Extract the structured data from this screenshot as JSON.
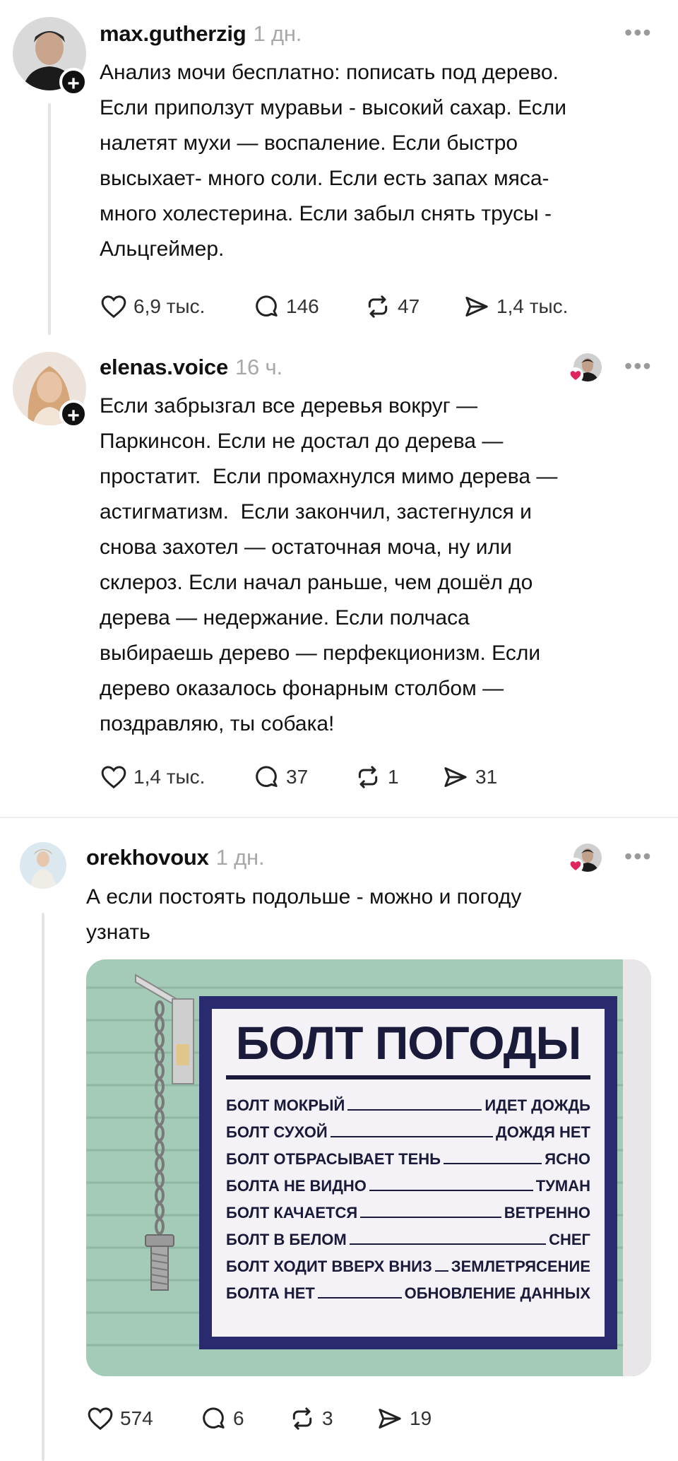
{
  "posts": [
    {
      "username": "max.gutherzig",
      "time": "1 дн.",
      "text": "Анализ мочи бесплатно: пописать под дерево.\nЕсли приползут муравьи - высокий сахар. Если\nналетят мухи — воспаление. Если быстро\nвысыхает- много соли. Если есть запах мяса-\nмного холестерина. Если забыл снять трусы -\nАльцгеймер.",
      "likes": "6,9 тыс.",
      "comments": "146",
      "reposts": "47",
      "shares": "1,4 тыс."
    },
    {
      "username": "elenas.voice",
      "time": "16 ч.",
      "text": "Если забрызгал все деревья вокруг —\nПаркинсон. Если не достал до дерева —\nпростатит.  Если промахнулся мимо дерева —\nастигматизм.  Если закончил, застегнулся и\nснова захотел — остаточная моча, ну или\nсклероз. Если начал раньше, чем дошёл до\nдерева — недержание. Если полчаса\nвыбираешь дерево — перфекционизм. Если\nдерево оказалось фонарным столбом —\nпоздравляю, ты собака!",
      "likes": "1,4 тыс.",
      "comments": "37",
      "reposts": "1",
      "shares": "31"
    },
    {
      "username": "orekhovoux",
      "time": "1 дн.",
      "text": "А если постоять подольше - можно и погоду\nузнать",
      "likes": "574",
      "comments": "6",
      "reposts": "3",
      "shares": "19"
    }
  ],
  "sign": {
    "title": "БОЛТ ПОГОДЫ",
    "rows": [
      {
        "left": "БОЛТ МОКРЫЙ",
        "right": "ИДЕТ ДОЖДЬ"
      },
      {
        "left": "БОЛТ СУХОЙ",
        "right": "ДОЖДЯ НЕТ"
      },
      {
        "left": "БОЛТ ОТБРАСЫВАЕТ ТЕНЬ",
        "right": "ЯСНО"
      },
      {
        "left": "БОЛТА НЕ ВИДНО",
        "right": "ТУМАН"
      },
      {
        "left": "БОЛТ КАЧАЕТСЯ",
        "right": "ВЕТРЕННО"
      },
      {
        "left": "БОЛТ В БЕЛОМ",
        "right": "СНЕГ"
      },
      {
        "left": "БОЛТ ХОДИТ ВВЕРХ ВНИЗ",
        "right": "ЗЕМЛЕТРЯСЕНИЕ"
      },
      {
        "left": "БОЛТА НЕТ",
        "right": "ОБНОВЛЕНИЕ ДАННЫХ"
      }
    ]
  },
  "icons": {
    "more": "more-horizontal-icon",
    "like": "heart-icon",
    "comment": "comment-bubble-icon",
    "repost": "repost-icon",
    "share": "share-send-icon",
    "follow": "plus-icon"
  },
  "colors": {
    "text": "#111111",
    "muted": "#a8a8a8",
    "heart_badge": "#e0245e",
    "sign_border": "#2a2a6e"
  }
}
